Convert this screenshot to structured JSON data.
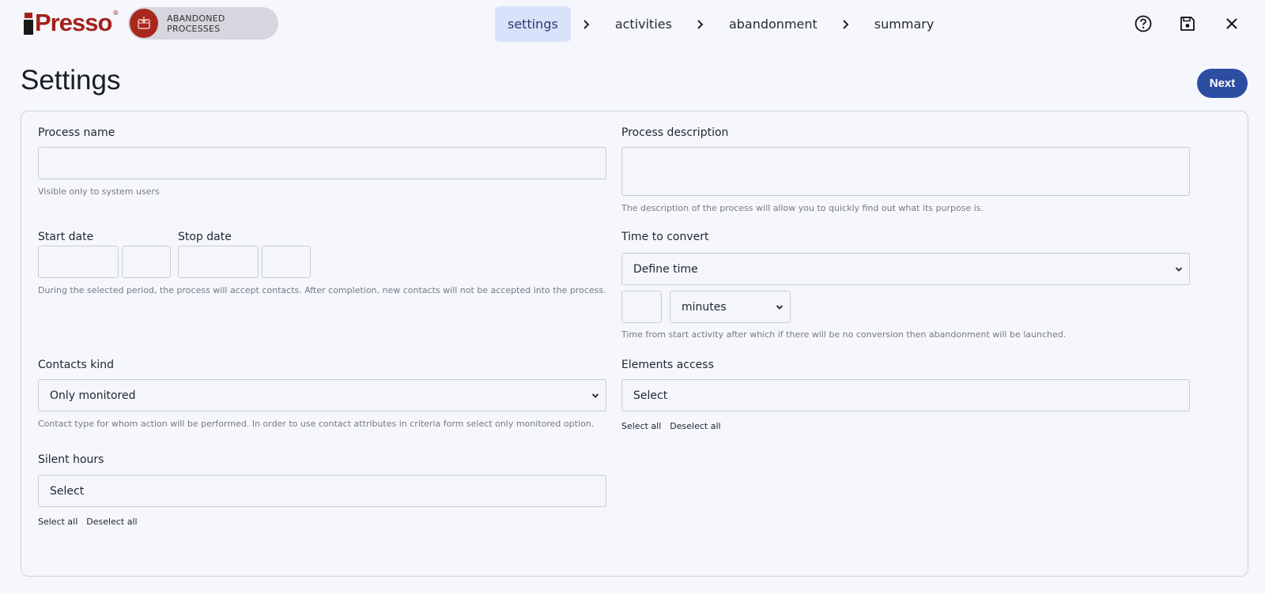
{
  "header": {
    "logo_text": "Presso",
    "logo_reg": "®",
    "module_label": "ABANDONED PROCESSES",
    "steps": [
      {
        "label": "settings",
        "active": true
      },
      {
        "label": "activities",
        "active": false
      },
      {
        "label": "abandonment",
        "active": false
      },
      {
        "label": "summary",
        "active": false
      }
    ],
    "icons": [
      "help-icon",
      "save-icon",
      "close-icon"
    ]
  },
  "page": {
    "title": "Settings",
    "next_label": "Next"
  },
  "form": {
    "process_name": {
      "label": "Process name",
      "value": "",
      "hint": "Visible only to system users"
    },
    "process_description": {
      "label": "Process description",
      "value": "",
      "hint": "The description of the process will allow you to quickly find out what its purpose is."
    },
    "start_date": {
      "label": "Start date",
      "date_value": "",
      "time_value": ""
    },
    "stop_date": {
      "label": "Stop date",
      "date_value": "",
      "time_value": ""
    },
    "period_hint": "During the selected period, the process will accept contacts. After completion, new contacts will not be accepted into the process.",
    "time_to_convert": {
      "label": "Time to convert",
      "selected": "Define time",
      "amount": "",
      "unit": "minutes",
      "hint": "Time from start activity after which if there will be no conversion then abandonment will be launched."
    },
    "contacts_kind": {
      "label": "Contacts kind",
      "selected": "Only monitored",
      "hint": "Contact type for whom action will be performed. In order to use contact attributes in criteria form select only monitored option."
    },
    "elements_access": {
      "label": "Elements access",
      "placeholder": "Select",
      "select_all": "Select all",
      "deselect_all": "Deselect all"
    },
    "silent_hours": {
      "label": "Silent hours",
      "placeholder": "Select",
      "select_all": "Select all",
      "deselect_all": "Deselect all"
    }
  },
  "colors": {
    "brand": "#a3231a",
    "primary_button": "#2c4ea1",
    "active_step_bg": "#d8e2fb",
    "page_bg": "#f6f7fd"
  }
}
